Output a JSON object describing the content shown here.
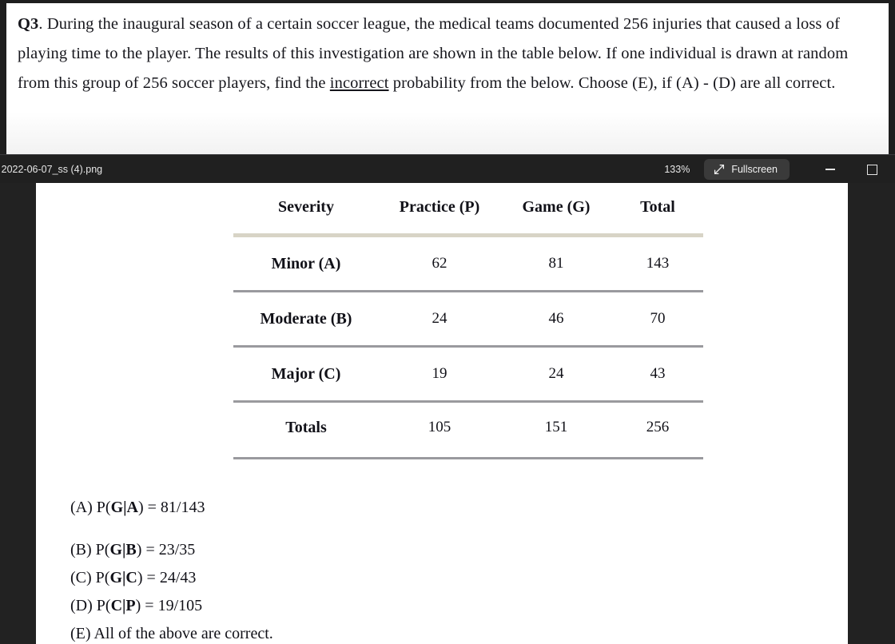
{
  "question": {
    "label": "Q3",
    "body_before_underline": ". During the inaugural season of a certain soccer league, the medical teams documented 256 injuries that caused a loss of playing time to the player. The results of this investigation are shown in the table below. If one individual is drawn at random from this group of 256 soccer players, find the ",
    "underlined_word": "incorrect",
    "body_after_underline": " probability from the below. Choose (E), if (A) - (D) are all correct."
  },
  "toolbar": {
    "filename": "- 2022-06-07_ss (4).png",
    "zoom_level": "133%",
    "fullscreen_label": "Fullscreen",
    "minimize_label": "",
    "maximize_label": ""
  },
  "table": {
    "headers": [
      "Severity",
      "Practice (P)",
      "Game (G)",
      "Total"
    ],
    "rows": [
      {
        "severity": "Minor (A)",
        "practice": "62",
        "game": "81",
        "total": "143"
      },
      {
        "severity": "Moderate (B)",
        "practice": "24",
        "game": "46",
        "total": "70"
      },
      {
        "severity": "Major (C)",
        "practice": "19",
        "game": "24",
        "total": "43"
      }
    ],
    "totals": {
      "severity": "Totals",
      "practice": "105",
      "game": "151",
      "total": "256"
    }
  },
  "answers": [
    {
      "tag": "(A)",
      "expr_prefix": "P(",
      "expr_bold": "G|A",
      "expr_suffix": ") = 81/143"
    },
    {
      "tag": "(B)",
      "expr_prefix": "P(",
      "expr_bold": "G|B",
      "expr_suffix": ") = 23/35"
    },
    {
      "tag": "(C)",
      "expr_prefix": "P(",
      "expr_bold": "G|C",
      "expr_suffix": ") = 24/43"
    },
    {
      "tag": "(D)",
      "expr_prefix": "P(",
      "expr_bold": "C|P",
      "expr_suffix": ") = 19/105"
    },
    {
      "tag": "(E)",
      "expr_prefix": "",
      "expr_bold": "",
      "expr_suffix": " All of the above are correct."
    }
  ],
  "colors": {
    "chrome_dark": "#1e1e1e",
    "toolbar_bg": "#202020",
    "viewer_bg": "#222222",
    "rule_beige": "#d8d4c6",
    "rule_gray": "#9a9a9e"
  }
}
